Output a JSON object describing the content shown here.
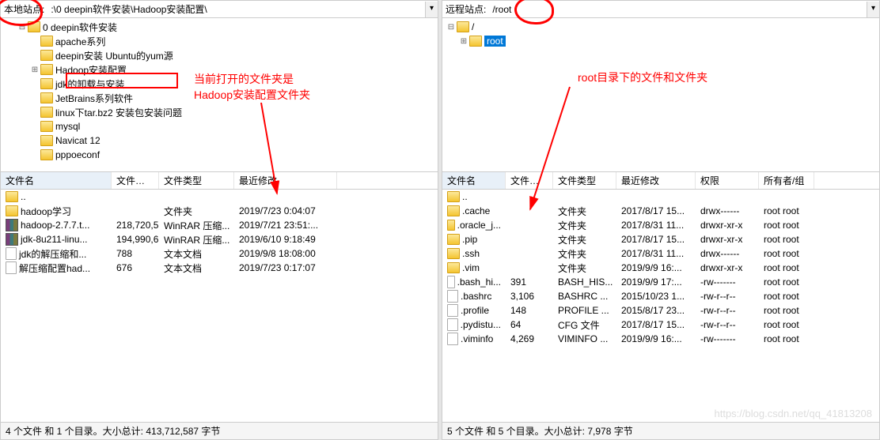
{
  "local": {
    "label": "本地站点:",
    "path": ":\\0 deepin软件安装\\Hadoop安装配置\\",
    "tree": [
      {
        "indent": 1,
        "toggle": "⊟",
        "icon": "folder",
        "label": "0 deepin软件安装"
      },
      {
        "indent": 2,
        "toggle": "",
        "icon": "folder",
        "label": "apache系列"
      },
      {
        "indent": 2,
        "toggle": "",
        "icon": "folder",
        "label": "deepin安装 Ubuntu的yum源"
      },
      {
        "indent": 2,
        "toggle": "⊞",
        "icon": "folder",
        "label": "Hadoop安装配置"
      },
      {
        "indent": 2,
        "toggle": "",
        "icon": "folder",
        "label": "jdk的卸载与安装"
      },
      {
        "indent": 2,
        "toggle": "",
        "icon": "folder",
        "label": "JetBrains系列软件"
      },
      {
        "indent": 2,
        "toggle": "",
        "icon": "folder",
        "label": "linux下tar.bz2 安装包安装问题"
      },
      {
        "indent": 2,
        "toggle": "",
        "icon": "folder",
        "label": "mysql"
      },
      {
        "indent": 2,
        "toggle": "",
        "icon": "folder",
        "label": "Navicat 12"
      },
      {
        "indent": 2,
        "toggle": "",
        "icon": "folder",
        "label": "pppoeconf"
      }
    ],
    "headers": {
      "name": "文件名",
      "size": "文件大小",
      "type": "文件类型",
      "date": "最近修改"
    },
    "files": [
      {
        "icon": "folder",
        "name": "..",
        "size": "",
        "type": "",
        "date": ""
      },
      {
        "icon": "folder",
        "name": "hadoop学习",
        "size": "",
        "type": "文件夹",
        "date": "2019/7/23 0:04:07"
      },
      {
        "icon": "rar",
        "name": "hadoop-2.7.7.t...",
        "size": "218,720,5...",
        "type": "WinRAR 压缩...",
        "date": "2019/7/21 23:51:..."
      },
      {
        "icon": "rar",
        "name": "jdk-8u211-linu...",
        "size": "194,990,6...",
        "type": "WinRAR 压缩...",
        "date": "2019/6/10 9:18:49"
      },
      {
        "icon": "file",
        "name": "jdk的解压缩和...",
        "size": "788",
        "type": "文本文档",
        "date": "2019/9/8 18:08:00"
      },
      {
        "icon": "file",
        "name": "解压缩配置had...",
        "size": "676",
        "type": "文本文档",
        "date": "2019/7/23 0:17:07"
      }
    ],
    "status": "4 个文件 和 1 个目录。大小总计: 413,712,587 字节"
  },
  "remote": {
    "label": "远程站点:",
    "path": "/root",
    "tree": [
      {
        "indent": 0,
        "toggle": "⊟",
        "icon": "folder",
        "label": "/"
      },
      {
        "indent": 1,
        "toggle": "⊞",
        "icon": "folder",
        "label": "root",
        "selected": true
      }
    ],
    "headers": {
      "name": "文件名",
      "size": "文件大小",
      "type": "文件类型",
      "date": "最近修改",
      "perm": "权限",
      "owner": "所有者/组"
    },
    "files": [
      {
        "icon": "folder",
        "name": "..",
        "size": "",
        "type": "",
        "date": "",
        "perm": "",
        "owner": ""
      },
      {
        "icon": "folder",
        "name": ".cache",
        "size": "",
        "type": "文件夹",
        "date": "2017/8/17 15...",
        "perm": "drwx------",
        "owner": "root root"
      },
      {
        "icon": "folder",
        "name": ".oracle_j...",
        "size": "",
        "type": "文件夹",
        "date": "2017/8/31 11...",
        "perm": "drwxr-xr-x",
        "owner": "root root"
      },
      {
        "icon": "folder",
        "name": ".pip",
        "size": "",
        "type": "文件夹",
        "date": "2017/8/17 15...",
        "perm": "drwxr-xr-x",
        "owner": "root root"
      },
      {
        "icon": "folder",
        "name": ".ssh",
        "size": "",
        "type": "文件夹",
        "date": "2017/8/31 11...",
        "perm": "drwx------",
        "owner": "root root"
      },
      {
        "icon": "folder",
        "name": ".vim",
        "size": "",
        "type": "文件夹",
        "date": "2019/9/9 16:...",
        "perm": "drwxr-xr-x",
        "owner": "root root"
      },
      {
        "icon": "file",
        "name": ".bash_hi...",
        "size": "391",
        "type": "BASH_HIS...",
        "date": "2019/9/9 17:...",
        "perm": "-rw-------",
        "owner": "root root"
      },
      {
        "icon": "file",
        "name": ".bashrc",
        "size": "3,106",
        "type": "BASHRC ...",
        "date": "2015/10/23 1...",
        "perm": "-rw-r--r--",
        "owner": "root root"
      },
      {
        "icon": "file",
        "name": ".profile",
        "size": "148",
        "type": "PROFILE ...",
        "date": "2015/8/17 23...",
        "perm": "-rw-r--r--",
        "owner": "root root"
      },
      {
        "icon": "file",
        "name": ".pydistu...",
        "size": "64",
        "type": "CFG 文件",
        "date": "2017/8/17 15...",
        "perm": "-rw-r--r--",
        "owner": "root root"
      },
      {
        "icon": "file",
        "name": ".viminfo",
        "size": "4,269",
        "type": "VIMINFO ...",
        "date": "2019/9/9 16:...",
        "perm": "-rw-------",
        "owner": "root root"
      }
    ],
    "status": "5 个文件 和 5 个目录。大小总计: 7,978 字节"
  },
  "annotations": {
    "current_folder": "当前打开的文件夹是\nHadoop安装配置文件夹",
    "root_folder": "root目录下的文件和文件夹"
  },
  "watermark": "https://blog.csdn.net/qq_41813208"
}
